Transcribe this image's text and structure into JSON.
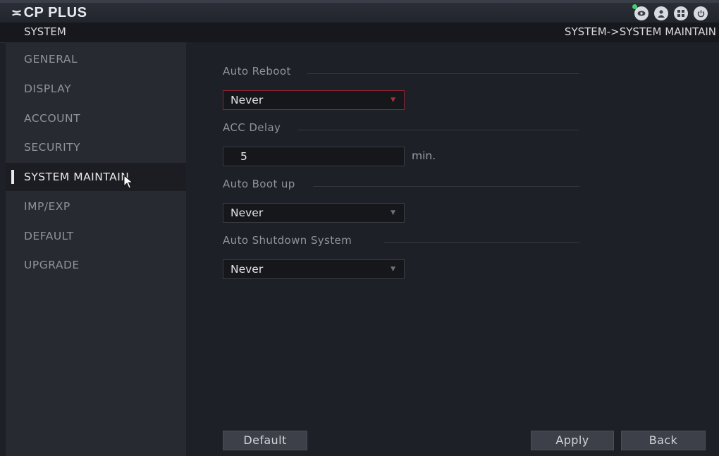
{
  "header": {
    "brand": "CP PLUS",
    "icons": [
      "live-view-icon",
      "user-icon",
      "menu-grid-icon",
      "power-icon"
    ],
    "status_dot_color": "#3fd06a"
  },
  "subheader": {
    "section": "SYSTEM",
    "breadcrumb": "SYSTEM->SYSTEM MAINTAIN"
  },
  "sidebar": {
    "items": [
      {
        "label": "GENERAL"
      },
      {
        "label": "DISPLAY"
      },
      {
        "label": "ACCOUNT"
      },
      {
        "label": "SECURITY"
      },
      {
        "label": "SYSTEM MAINTAIN",
        "active": true
      },
      {
        "label": "IMP/EXP"
      },
      {
        "label": "DEFAULT"
      },
      {
        "label": "UPGRADE"
      }
    ]
  },
  "form": {
    "auto_reboot": {
      "label": "Auto Reboot",
      "value": "Never"
    },
    "acc_delay": {
      "label": "ACC Delay",
      "value": "5",
      "unit": "min."
    },
    "auto_boot_up": {
      "label": "Auto Boot up",
      "value": "Never"
    },
    "auto_shutdown": {
      "label": "Auto Shutdown System",
      "value": "Never"
    }
  },
  "buttons": {
    "default": "Default",
    "apply": "Apply",
    "back": "Back"
  }
}
